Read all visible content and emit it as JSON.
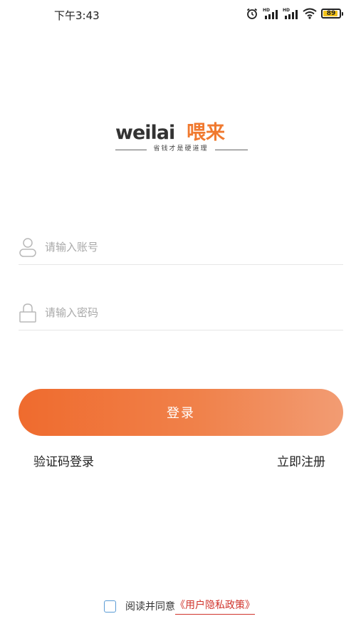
{
  "status_bar": {
    "time": "下午3:43",
    "signal_1_label": "HD",
    "signal_2_label": "HD",
    "battery_level": "89",
    "icons": [
      "alarm-icon",
      "signal-hd-icon",
      "signal-hd-icon",
      "wifi-icon",
      "battery-icon"
    ]
  },
  "logo": {
    "word": "weilai",
    "chinese": "喂来",
    "slogan": "省钱才是硬道理",
    "brand_color": "#f0792f"
  },
  "form": {
    "account_placeholder": "请输入账号",
    "password_placeholder": "请输入密码",
    "account_icon": "user-icon",
    "password_icon": "lock-icon"
  },
  "actions": {
    "login_label": "登录",
    "sms_login_label": "验证码登录",
    "register_label": "立即注册"
  },
  "agreement": {
    "text": "阅读并同意",
    "policy_link": "《用户隐私政策》",
    "checked": false
  },
  "colors": {
    "accent": "#ef6b2e",
    "link_red": "#d0342c",
    "checkbox_blue": "#5a9bd5"
  }
}
